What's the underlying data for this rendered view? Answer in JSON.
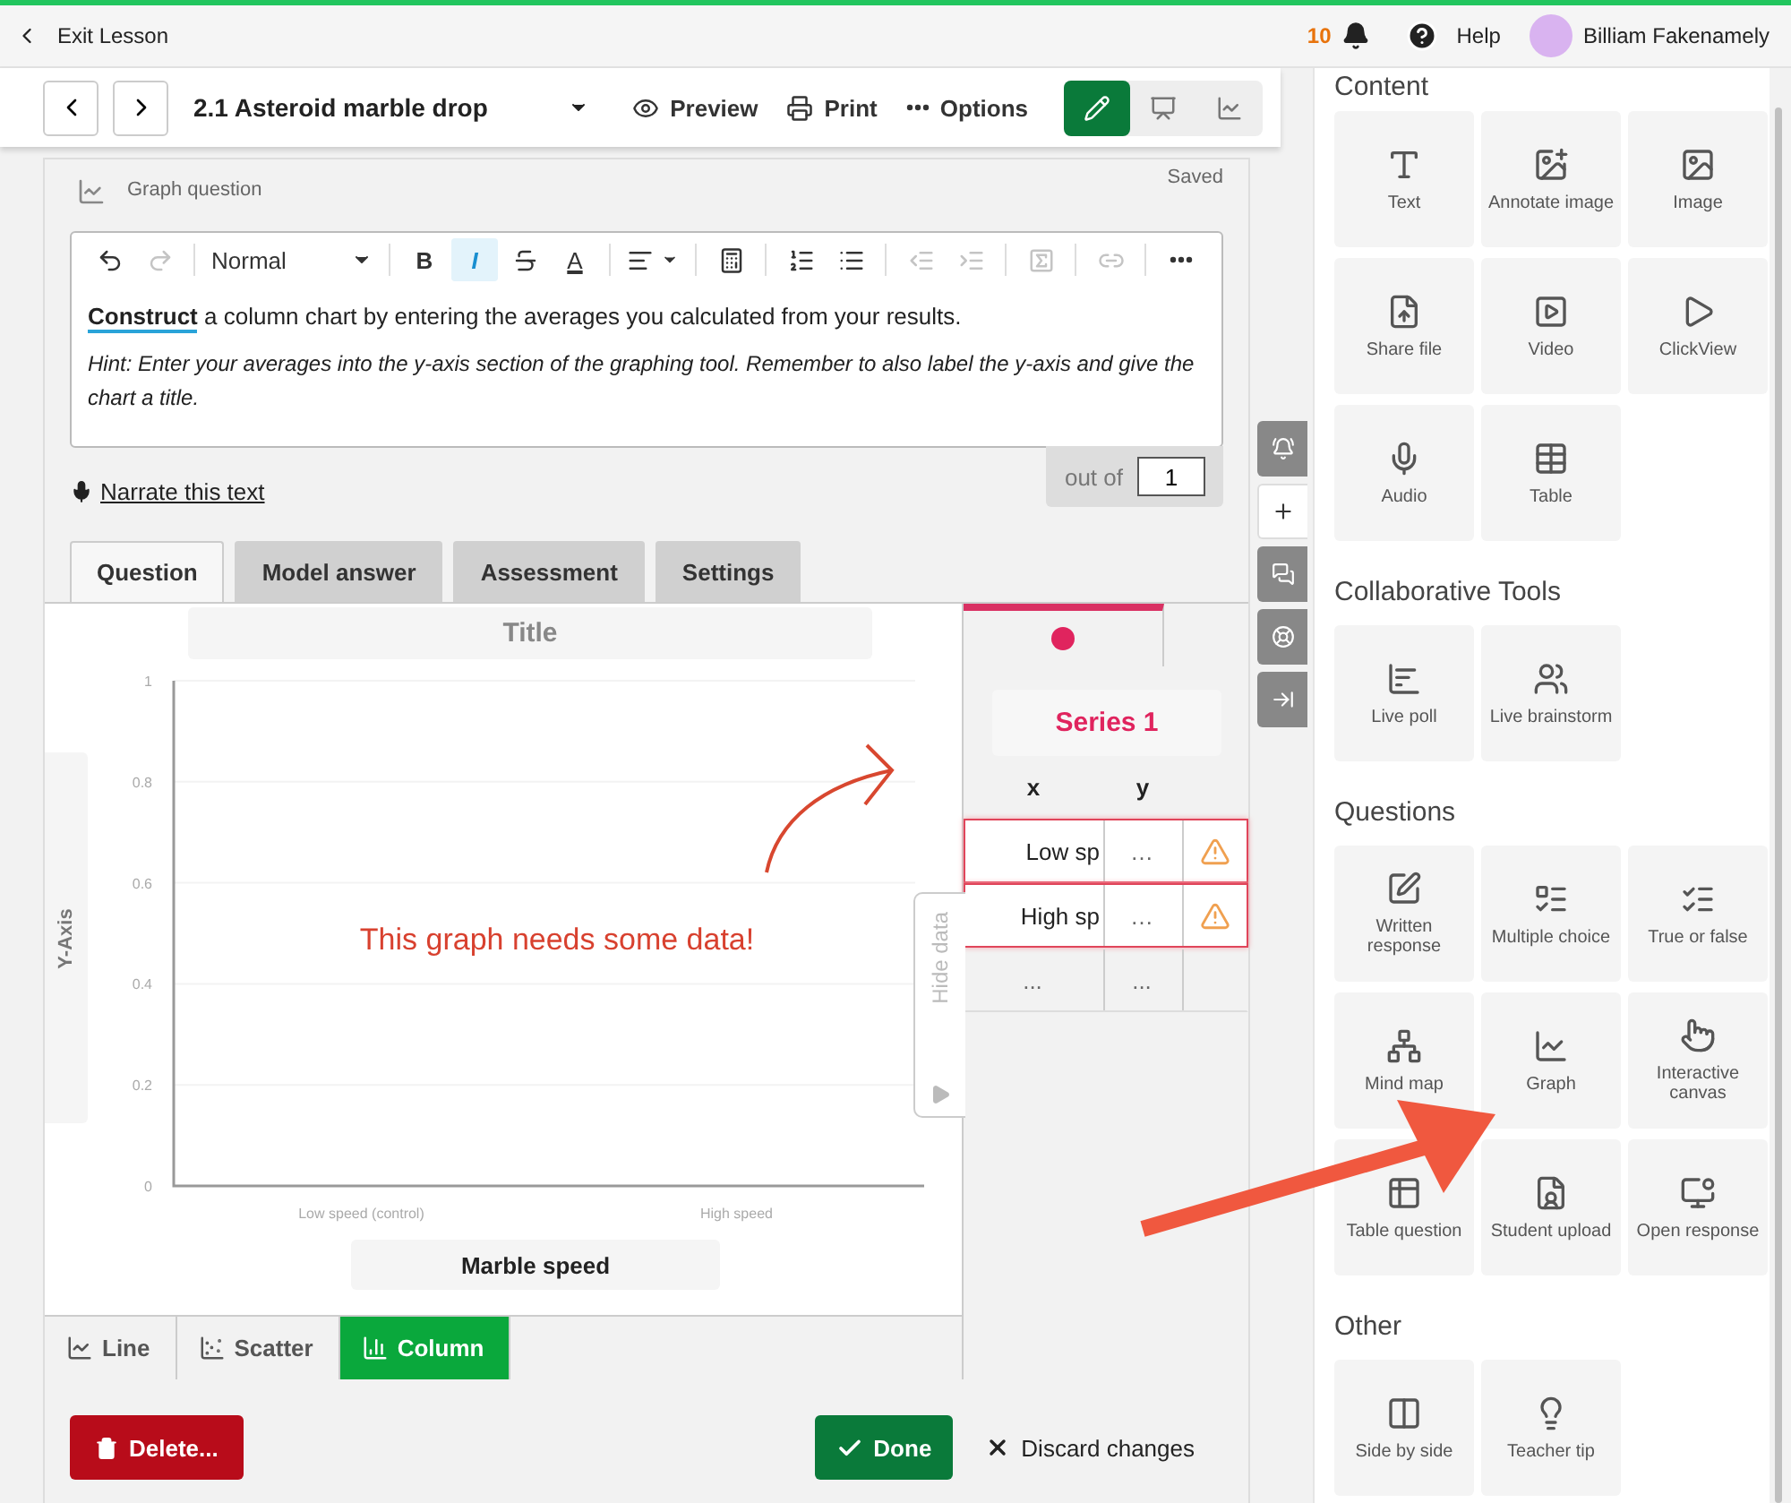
{
  "top_bar": {
    "exit": "Exit Lesson",
    "notification_count": "10",
    "help": "Help",
    "user_name": "Billiam Fakenamely"
  },
  "lesson_bar": {
    "title": "2.1 Asteroid marble drop",
    "actions": [
      {
        "kind": "preview",
        "label": "Preview"
      },
      {
        "kind": "print",
        "label": "Print"
      },
      {
        "kind": "options",
        "label": "Options"
      }
    ],
    "modes": [
      {
        "kind": "edit",
        "selected": true
      },
      {
        "kind": "present",
        "selected": false
      },
      {
        "kind": "analytics",
        "selected": false
      }
    ]
  },
  "block": {
    "type_label": "Graph question",
    "save_status": "Saved",
    "editor_toolbar": [
      {
        "kind": "undo",
        "disabled": false
      },
      {
        "kind": "redo",
        "disabled": true
      },
      {
        "kind": "style",
        "label": "Normal",
        "disabled": false
      },
      {
        "kind": "bold",
        "label": "B",
        "active": false,
        "disabled": false
      },
      {
        "kind": "italic",
        "label": "I",
        "active": true,
        "disabled": false
      },
      {
        "kind": "strike",
        "disabled": false
      },
      {
        "kind": "color",
        "label": "A",
        "disabled": false
      },
      {
        "kind": "align",
        "disabled": false
      },
      {
        "kind": "formula",
        "disabled": false
      },
      {
        "kind": "ordered",
        "disabled": false
      },
      {
        "kind": "bullets",
        "disabled": false
      },
      {
        "kind": "outdent",
        "disabled": true
      },
      {
        "kind": "indent",
        "disabled": true
      },
      {
        "kind": "media",
        "disabled": true
      },
      {
        "kind": "link",
        "disabled": true
      },
      {
        "kind": "more",
        "disabled": false
      }
    ],
    "body": "**Construct** a column chart by entering the averages you calculated from your results.",
    "hint": "Hint: Enter your averages into the y-axis section of the graphing tool. Remember to also label the y-axis and give the chart a title.",
    "narrate": "Narrate this text",
    "out_of_label": "out of",
    "out_of_value": "1",
    "tabs": [
      {
        "label": "Question",
        "selected": true
      },
      {
        "label": "Model answer",
        "selected": false
      },
      {
        "label": "Assessment",
        "selected": false
      },
      {
        "label": "Settings",
        "selected": false
      }
    ],
    "graph": {
      "chart_data": {
        "type": "bar",
        "grid": true,
        "title": "Title",
        "xlabel": "Marble speed",
        "ylabel": "Y-Axis",
        "categories": [
          "Low speed (control)",
          "High speed"
        ],
        "series": [
          {
            "name": "Series 1",
            "color": "#e0245e",
            "values": [
              null,
              null
            ]
          }
        ],
        "ylim": [
          0,
          1
        ],
        "yticks": [
          0,
          0.2,
          0.4,
          0.6,
          0.8,
          1
        ]
      },
      "empty_message": "This graph needs some data!",
      "hide_data": "Hide data",
      "chart_types": [
        {
          "kind": "line",
          "label": "Line",
          "selected": false
        },
        {
          "kind": "scatter",
          "label": "Scatter",
          "selected": false
        },
        {
          "kind": "column",
          "label": "Column",
          "selected": true
        }
      ],
      "columns": [
        "x",
        "y"
      ],
      "rows": [
        {
          "x": "Low sp",
          "y": "…",
          "error": true
        },
        {
          "x": "High sp",
          "y": "…",
          "error": true
        },
        {
          "x": "...",
          "y": "...",
          "error": false
        }
      ]
    },
    "delete": "Delete...",
    "done": "Done",
    "discard": "Discard changes"
  },
  "side_strip": [
    {
      "kind": "announce",
      "selected": false
    },
    {
      "kind": "add",
      "selected": true
    },
    {
      "kind": "chat",
      "selected": false
    },
    {
      "kind": "help",
      "selected": false
    },
    {
      "kind": "collapse",
      "selected": false
    }
  ],
  "panel": {
    "sections": [
      {
        "heading": "Content",
        "items": [
          {
            "kind": "text",
            "label": "Text"
          },
          {
            "kind": "annotate",
            "label": "Annotate image"
          },
          {
            "kind": "image",
            "label": "Image"
          },
          {
            "kind": "share",
            "label": "Share file"
          },
          {
            "kind": "video",
            "label": "Video"
          },
          {
            "kind": "clickview",
            "label": "ClickView"
          },
          {
            "kind": "audio",
            "label": "Audio"
          },
          {
            "kind": "table",
            "label": "Table"
          }
        ]
      },
      {
        "heading": "Collaborative Tools",
        "items": [
          {
            "kind": "poll",
            "label": "Live poll"
          },
          {
            "kind": "brainstorm",
            "label": "Live brainstorm"
          }
        ]
      },
      {
        "heading": "Questions",
        "items": [
          {
            "kind": "written",
            "label": "Written response"
          },
          {
            "kind": "multiple",
            "label": "Multiple choice"
          },
          {
            "kind": "truefalse",
            "label": "True or false"
          },
          {
            "kind": "mindmap",
            "label": "Mind map"
          },
          {
            "kind": "graph",
            "label": "Graph"
          },
          {
            "kind": "canvas",
            "label": "Interactive canvas"
          },
          {
            "kind": "tablequestion",
            "label": "Table question"
          },
          {
            "kind": "upload",
            "label": "Student upload"
          },
          {
            "kind": "open",
            "label": "Open response"
          }
        ]
      },
      {
        "heading": "Other",
        "items": [
          {
            "kind": "sidebyside",
            "label": "Side by side"
          },
          {
            "kind": "tip",
            "label": "Teacher tip"
          }
        ]
      }
    ]
  }
}
